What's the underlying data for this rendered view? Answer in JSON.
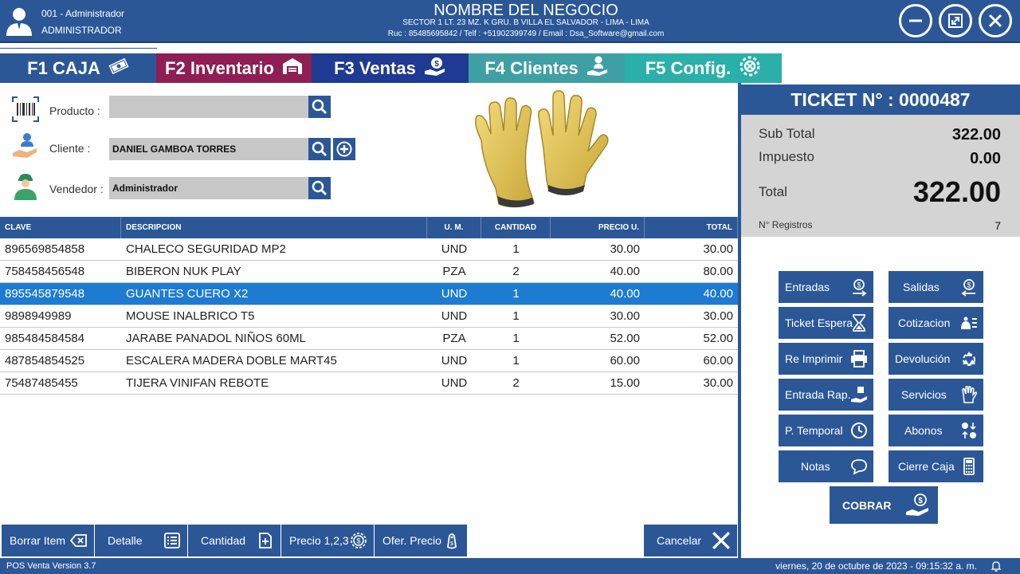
{
  "header": {
    "user_line1": "001 - Administrador",
    "user_line2": "ADMINISTRADOR",
    "business_name": "NOMBRE DEL NEGOCIO",
    "business_address": "SECTOR 1 LT. 23 MZ. K GRU. B VILLA EL SALVADOR - LIMA - LIMA",
    "business_ruc": "Ruc : 85485695842 / Telf : +51902399749 / Email : Dsa_Software@gmail.com",
    "window_buttons": [
      "minimize-icon",
      "maximize-icon",
      "close-icon"
    ]
  },
  "tabs": [
    {
      "label": "F1 CAJA",
      "color": "#2b5797",
      "icon": "money-icon",
      "active": true
    },
    {
      "label": "F2 Inventario",
      "color": "#8e1e54",
      "icon": "warehouse-icon"
    },
    {
      "label": "F3 Ventas",
      "color": "#1f3a93",
      "icon": "hand-money-icon"
    },
    {
      "label": "F4 Clientes",
      "color": "#3ea0a4",
      "icon": "customer-icon"
    },
    {
      "label": "F5 Config.",
      "color": "#2ab0a8",
      "icon": "gear-icon"
    }
  ],
  "form": {
    "producto_label": "Producto :",
    "producto_value": "",
    "cliente_label": "Cliente :",
    "cliente_value": "DANIEL GAMBOA TORRES",
    "vendedor_label": "Vendedor :",
    "vendedor_value": "Administrador"
  },
  "table": {
    "headers": [
      "CLAVE",
      "DESCRIPCION",
      "U. M.",
      "CANTIDAD",
      "PRECIO U.",
      "TOTAL"
    ],
    "rows": [
      {
        "clave": "896569854858",
        "desc": "CHALECO SEGURIDAD MP2",
        "um": "UND",
        "cant": "1",
        "precio": "30.00",
        "total": "30.00"
      },
      {
        "clave": "758458456548",
        "desc": "BIBERON NUK PLAY",
        "um": "PZA",
        "cant": "2",
        "precio": "40.00",
        "total": "80.00"
      },
      {
        "clave": "895545879548",
        "desc": "GUANTES CUERO X2",
        "um": "UND",
        "cant": "1",
        "precio": "40.00",
        "total": "40.00",
        "selected": true
      },
      {
        "clave": "9898949989",
        "desc": "MOUSE INALBRICO T5",
        "um": "UND",
        "cant": "1",
        "precio": "30.00",
        "total": "30.00"
      },
      {
        "clave": "985484584584",
        "desc": "JARABE PANADOL NIÑOS 60ML",
        "um": "PZA",
        "cant": "1",
        "precio": "52.00",
        "total": "52.00"
      },
      {
        "clave": "487854854525",
        "desc": "ESCALERA MADERA DOBLE MART45",
        "um": "UND",
        "cant": "1",
        "precio": "60.00",
        "total": "60.00"
      },
      {
        "clave": "75487485455",
        "desc": "TIJERA VINIFAN REBOTE",
        "um": "UND",
        "cant": "2",
        "precio": "15.00",
        "total": "30.00"
      }
    ]
  },
  "ticket": {
    "title": "TICKET N° : 0000487",
    "subtotal_label": "Sub Total",
    "subtotal_value": "322.00",
    "impuesto_label": "Impuesto",
    "impuesto_value": "0.00",
    "total_label": "Total",
    "total_value": "322.00",
    "registros_label": "N° Registros",
    "registros_value": "7"
  },
  "actions": {
    "entradas": "Entradas",
    "salidas": "Salidas",
    "ticket_espera": "Ticket Espera",
    "cotizacion": "Cotizacion",
    "re_imprimir": "Re Imprimir",
    "devolucion": "Devolución",
    "entrada_rap": "Entrada Rap.",
    "servicios": "Servicios",
    "p_temporal": "P. Temporal",
    "abonos": "Abonos",
    "notas": "Notas",
    "cierre_caja": "Cierre Caja",
    "cobrar": "COBRAR"
  },
  "bottom": {
    "borrar_item": "Borrar Item",
    "detalle": "Detalle",
    "cantidad": "Cantidad",
    "precio": "Precio 1,2,3",
    "ofer_precio": "Ofer. Precio",
    "cancelar": "Cancelar"
  },
  "status": {
    "version": "POS Venta Version 3.7",
    "datetime": "viernes, 20 de octubre de 2023 - 09:15:32 a. m."
  },
  "colors": {
    "primary": "#2b5797",
    "selected_row": "#1e7bd2",
    "summary_bg": "#d4d4d4",
    "input_bg": "#c7c7c7"
  }
}
